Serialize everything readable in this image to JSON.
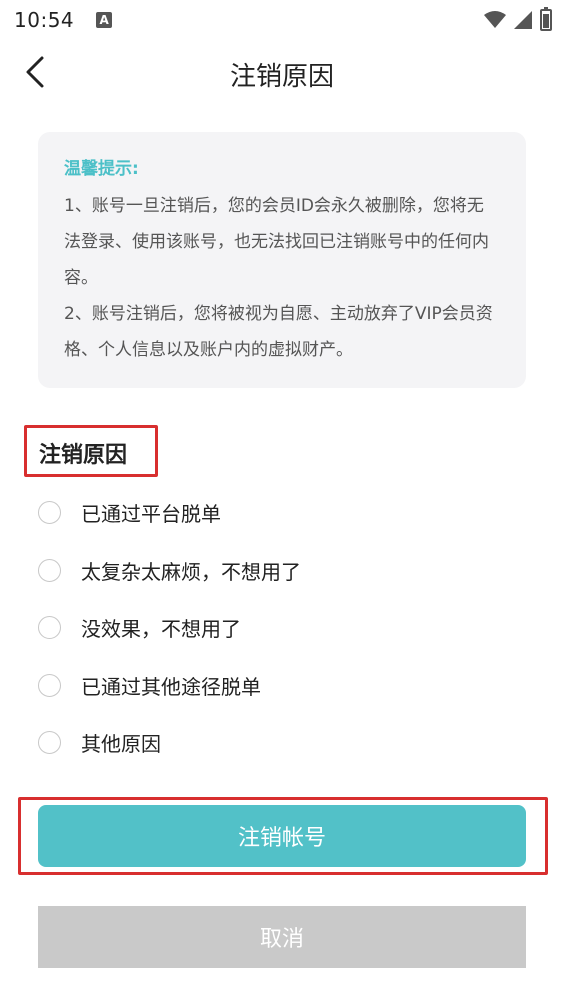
{
  "status_bar": {
    "time": "10:54",
    "notification_icon": "A"
  },
  "header": {
    "title": "注销原因"
  },
  "notice": {
    "title": "温馨提示:",
    "line1": "1、账号一旦注销后，您的会员ID会永久被删除，您将无法登录、使用该账号，也无法找回已注销账号中的任何内容。",
    "line2": "2、账号注销后，您将被视为自愿、主动放弃了VIP会员资格、个人信息以及账户内的虚拟财产。"
  },
  "reasons": {
    "heading": "注销原因",
    "options": [
      "已通过平台脱单",
      "太复杂太麻烦，不想用了",
      "没效果，不想用了",
      "已通过其他途径脱单",
      "其他原因"
    ]
  },
  "actions": {
    "submit_label": "注销帐号",
    "cancel_label": "取消"
  },
  "colors": {
    "accent": "#52c1c8",
    "notice_title": "#4cc0c8",
    "highlight_box": "#d82f2f",
    "cancel_bg": "#c9c9c9"
  }
}
